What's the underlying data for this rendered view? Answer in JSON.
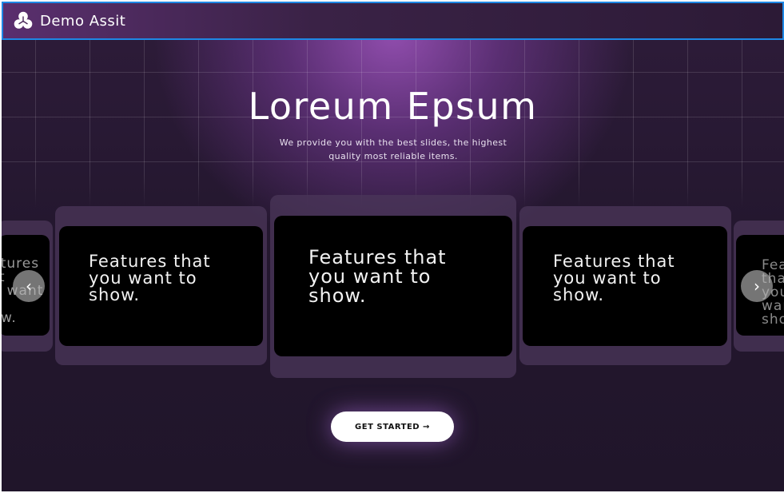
{
  "app": {
    "brand": "Demo Assit",
    "logo_icon": "trefoil-logo-icon"
  },
  "hero": {
    "title": "Loreum Epsum",
    "subtitle_line1": "We provide you with the best slides, the highest",
    "subtitle_line2": "quality most reliable items."
  },
  "carousel": {
    "prev_icon": "chevron-left-icon",
    "next_icon": "chevron-right-icon",
    "prev_glyph": "‹",
    "next_glyph": "›",
    "slides": [
      {
        "line1": "Features that",
        "line2": "you want to",
        "line3": "show."
      },
      {
        "line1": "Features that",
        "line2": "you want to",
        "line3": "show."
      },
      {
        "line1": "Features that",
        "line2": "you want to",
        "line3": "show."
      },
      {
        "line1": "Features that",
        "line2": "you want to",
        "line3": "show."
      },
      {
        "line1": "Features that",
        "line2": "you want to",
        "line3": "show."
      }
    ]
  },
  "cta": {
    "label": "GET STARTED →"
  },
  "colors": {
    "accent_border": "#1e88e5",
    "background": "#24172f",
    "glow": "#8e4aa8"
  }
}
